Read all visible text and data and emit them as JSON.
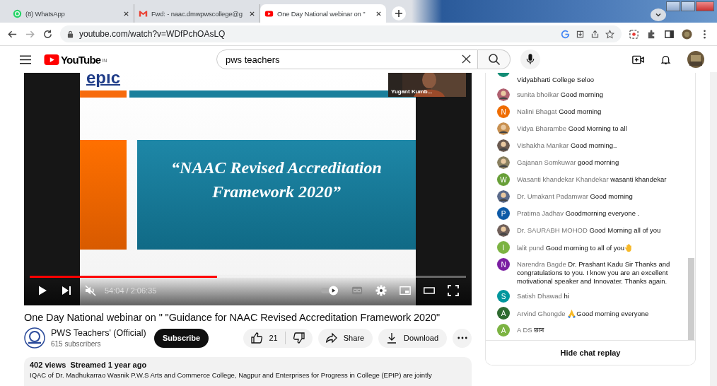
{
  "browser": {
    "tabs": [
      {
        "title": "(8) WhatsApp",
        "selected": false
      },
      {
        "title": "Fwd: - naac.dmwpwscollege@g",
        "selected": false
      },
      {
        "title": "One Day National webinar on \"",
        "selected": true
      }
    ],
    "url": "youtube.com/watch?v=WDfPchOAsLQ"
  },
  "header": {
    "logo": "YouTube",
    "region": "IN",
    "search": {
      "value": "pws teachers"
    }
  },
  "video": {
    "slide": {
      "brand": "epic",
      "title": "“NAAC Revised Accreditation Framework 2020”",
      "speaker": "Yugant Kumb..."
    },
    "level": 0.43,
    "time": "54:04 / 2:06:35",
    "muted": true
  },
  "title": "One Day National webinar on \" \"Guidance for NAAC Revised Accreditation Framework 2020\"",
  "channel": {
    "name": "PWS Teachers' (Official)",
    "subscribers": "615 subscribers",
    "subscribe": "Subscribe"
  },
  "actions": {
    "likes": "21",
    "share": "Share",
    "download": "Download"
  },
  "description": {
    "meta": "402 views  Streamed 1 year ago",
    "text": "IQAC of Dr. Madhukarrao Wasnik P.W.S Arts and Commerce College, Nagpur and Enterprises for Progress in College (EPIP) are jointly"
  },
  "chat": {
    "messages": [
      {
        "kind": "partial",
        "color": "#138d75",
        "message": "Vidyabharti College Seloo"
      },
      {
        "color": "#b06070",
        "author": "sunita bhoikar",
        "message": "Good morning"
      },
      {
        "kind": "letter",
        "letter": "N",
        "color": "#ef6c00",
        "author": "Nalini Bhagat",
        "message": "Good morning"
      },
      {
        "color": "#c89050",
        "author": "Vidya Bharambe",
        "message": "Good Morning to all"
      },
      {
        "color": "#6a5a50",
        "author": "Vishakha Mankar",
        "message": "Good morning.."
      },
      {
        "color": "#8a8060",
        "author": "Gajanan Somkuwar",
        "message": "good morning"
      },
      {
        "kind": "letter",
        "letter": "W",
        "color": "#689f38",
        "author": "Wasanti khandekar Khandekar",
        "message": "wasanti khandekar"
      },
      {
        "color": "#5a6a8a",
        "author": "Dr. Umakant Padamwar",
        "message": "Good morning"
      },
      {
        "kind": "letter",
        "letter": "P",
        "color": "#0d5aa7",
        "author": "Pratima Jadhav",
        "message": "Goodmorning everyone ."
      },
      {
        "color": "#70605a",
        "author": "Dr. SAURABH MOHOD",
        "message": "Good Morning all of you"
      },
      {
        "kind": "letter",
        "letter": "I",
        "color": "#7cb342",
        "author": "lalit pund",
        "message": "Good morning to all of you",
        "emoji": {
          "kind": "hand",
          "leading": false
        }
      },
      {
        "kind": "letter",
        "letter": "N",
        "color": "#7b1fa2",
        "author": "Narendra Bagde",
        "message": "Dr. Prashant Kadu Sir Thanks and congratulations to you. I know you are an excellent motivational speaker and Innovater. Thanks again."
      },
      {
        "kind": "letter",
        "letter": "S",
        "color": "#00979d",
        "author": "Satish Dhawad",
        "message": "hi"
      },
      {
        "kind": "letter",
        "letter": "A",
        "color": "#2e6b30",
        "author": "Arvind Ghongde",
        "message": "Good morning everyone",
        "emoji": {
          "kind": "pray",
          "leading": true
        }
      },
      {
        "kind": "letter",
        "letter": "A",
        "color": "#7cb342",
        "author": "A DS",
        "message": "छान"
      }
    ],
    "hide": "Hide chat replay"
  }
}
